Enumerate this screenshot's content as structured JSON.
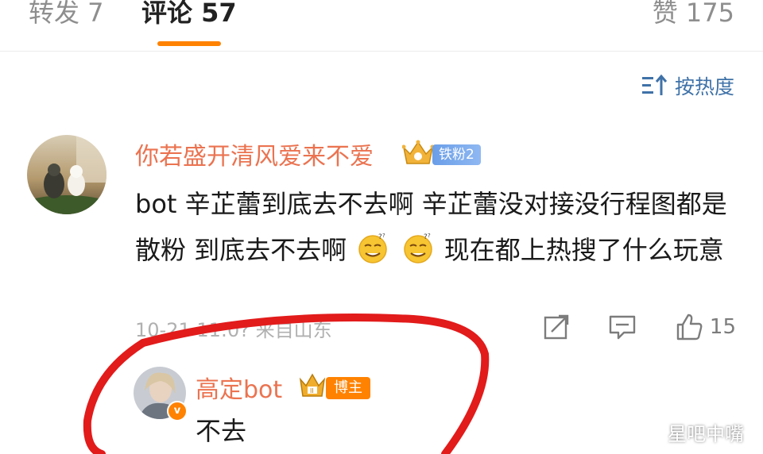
{
  "tabs": {
    "repost": "转发 7",
    "comment": "评论 57",
    "like": "赞 175"
  },
  "sort": {
    "label": "按热度"
  },
  "comment": {
    "username": "你若盛开清风爱来不爱",
    "fan_badge": "铁粉2",
    "text_before": "bot 辛芷蕾到底去不去啊 辛芷蕾没对接没行程图都是散粉 到底去不去啊",
    "text_after": "现在都上热搜了什么玩意",
    "meta": "10-21 11:0? 来自山东",
    "likes": "15"
  },
  "reply": {
    "username": "高定bot",
    "host_badge": "博主",
    "text": "不去"
  },
  "watermark": {
    "text": "星吧中嘴"
  },
  "colors": {
    "accent": "#ff8200",
    "username": "#eb7350",
    "link": "#3f72a8",
    "annotation": "#e21b1b"
  },
  "icons": [
    "sort-icon",
    "crown-icon",
    "verified-icon",
    "emoji-icon",
    "share-icon",
    "comment-icon",
    "like-icon",
    "weibo-icon"
  ]
}
